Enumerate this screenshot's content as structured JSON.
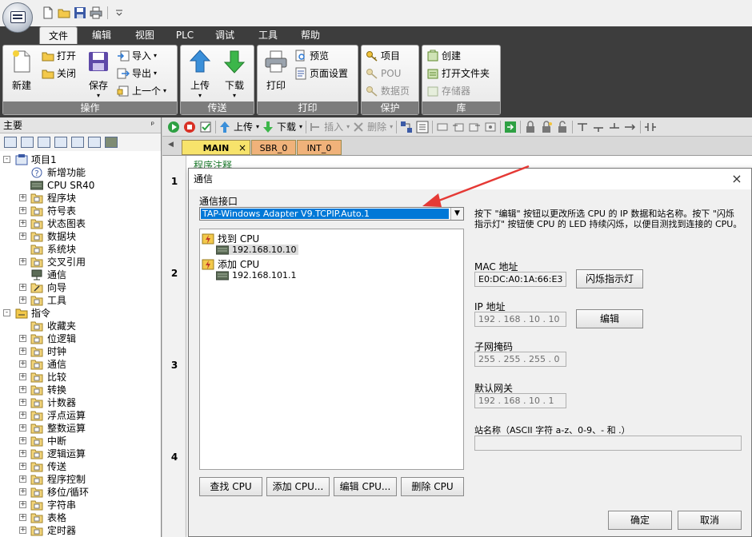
{
  "ribbon_tabs": [
    "文件",
    "编辑",
    "视图",
    "PLC",
    "调试",
    "工具",
    "帮助"
  ],
  "ribbon": {
    "groups": {
      "operate": "操作",
      "transfer": "传送",
      "print": "打印",
      "protect": "保护",
      "library": "库"
    },
    "new": "新建",
    "open": "打开",
    "close": "关闭",
    "save": "保存",
    "import": "导入",
    "export": "导出",
    "previous": "上一个",
    "upload": "上传",
    "download": "下载",
    "print": "打印",
    "preview": "预览",
    "page_setup": "页面设置",
    "project": "项目",
    "pou": "POU",
    "data_page": "数据页",
    "create": "创建",
    "open_folder": "打开文件夹",
    "memory": "存储器"
  },
  "left_panel": {
    "title": "主要",
    "pin": "ᵖ",
    "tree": [
      {
        "label": "项目1",
        "level": 0,
        "exp": "-",
        "icon": "project"
      },
      {
        "label": "新增功能",
        "level": 1,
        "exp": "",
        "icon": "help"
      },
      {
        "label": "CPU SR40",
        "level": 1,
        "exp": "",
        "icon": "cpu"
      },
      {
        "label": "程序块",
        "level": 1,
        "exp": "+",
        "icon": "folder"
      },
      {
        "label": "符号表",
        "level": 1,
        "exp": "+",
        "icon": "folder"
      },
      {
        "label": "状态图表",
        "level": 1,
        "exp": "+",
        "icon": "folder"
      },
      {
        "label": "数据块",
        "level": 1,
        "exp": "+",
        "icon": "folder"
      },
      {
        "label": "系统块",
        "level": 1,
        "exp": "",
        "icon": "folder"
      },
      {
        "label": "交叉引用",
        "level": 1,
        "exp": "+",
        "icon": "folder"
      },
      {
        "label": "通信",
        "level": 1,
        "exp": "",
        "icon": "comm"
      },
      {
        "label": "向导",
        "level": 1,
        "exp": "+",
        "icon": "wizard"
      },
      {
        "label": "工具",
        "level": 1,
        "exp": "+",
        "icon": "folder"
      },
      {
        "label": "指令",
        "level": 0,
        "exp": "-",
        "icon": "instr"
      },
      {
        "label": "收藏夹",
        "level": 1,
        "exp": "",
        "icon": "folder"
      },
      {
        "label": "位逻辑",
        "level": 1,
        "exp": "+",
        "icon": "folder"
      },
      {
        "label": "时钟",
        "level": 1,
        "exp": "+",
        "icon": "folder"
      },
      {
        "label": "通信",
        "level": 1,
        "exp": "+",
        "icon": "folder"
      },
      {
        "label": "比较",
        "level": 1,
        "exp": "+",
        "icon": "folder"
      },
      {
        "label": "转换",
        "level": 1,
        "exp": "+",
        "icon": "folder"
      },
      {
        "label": "计数器",
        "level": 1,
        "exp": "+",
        "icon": "folder"
      },
      {
        "label": "浮点运算",
        "level": 1,
        "exp": "+",
        "icon": "folder"
      },
      {
        "label": "整数运算",
        "level": 1,
        "exp": "+",
        "icon": "folder"
      },
      {
        "label": "中断",
        "level": 1,
        "exp": "+",
        "icon": "folder"
      },
      {
        "label": "逻辑运算",
        "level": 1,
        "exp": "+",
        "icon": "folder"
      },
      {
        "label": "传送",
        "level": 1,
        "exp": "+",
        "icon": "folder"
      },
      {
        "label": "程序控制",
        "level": 1,
        "exp": "+",
        "icon": "folder"
      },
      {
        "label": "移位/循环",
        "level": 1,
        "exp": "+",
        "icon": "folder"
      },
      {
        "label": "字符串",
        "level": 1,
        "exp": "+",
        "icon": "folder"
      },
      {
        "label": "表格",
        "level": 1,
        "exp": "+",
        "icon": "folder"
      },
      {
        "label": "定时器",
        "level": 1,
        "exp": "+",
        "icon": "folder"
      }
    ]
  },
  "main_toolbar": {
    "upload": "上传",
    "download": "下载",
    "insert": "插入",
    "delete": "删除"
  },
  "doc_tabs": [
    "MAIN",
    "SBR_0",
    "INT_0"
  ],
  "doc_tab_close": "×",
  "editor": {
    "program_comment": "程序注释",
    "rungs": [
      "1",
      "2",
      "3",
      "4"
    ]
  },
  "dialog": {
    "title": "通信",
    "close": "×",
    "interface_label": "通信接口",
    "interface_value": "TAP-Windows Adapter V9.TCPIP.Auto.1",
    "tree": {
      "found": "找到 CPU",
      "found_ip": "192.168.10.10",
      "add": "添加 CPU",
      "add_ip": "192.168.101.1"
    },
    "buttons": {
      "find": "查找 CPU",
      "add": "添加 CPU...",
      "edit_cpu": "编辑 CPU...",
      "remove": "删除 CPU",
      "flash": "闪烁指示灯",
      "edit": "编辑",
      "ok": "确定",
      "cancel": "取消"
    },
    "info": "按下 \"编辑\" 按钮以更改所选 CPU 的 IP 数据和站名称。按下 \"闪烁指示灯\" 按钮使 CPU 的 LED 持续闪烁，以便目测找到连接的 CPU。",
    "mac_label": "MAC 地址",
    "mac_value": "E0:DC:A0:1A:66:E3",
    "ip_label": "IP 地址",
    "ip_value": "192 . 168 . 10 . 10",
    "mask_label": "子网掩码",
    "mask_value": "255 . 255 . 255 . 0",
    "gw_label": "默认网关",
    "gw_value": "192 . 168 . 10 . 1",
    "station_label": "站名称（ASCII 字符 a-z、0-9、- 和 .）",
    "station_value": ""
  },
  "colors": {
    "ribbon_dark": "#3d3d3d",
    "selection": "#0078d7",
    "annotation_arrow": "#e53935",
    "main_tab": "#f7e36b",
    "other_tab": "#f0b27a"
  }
}
